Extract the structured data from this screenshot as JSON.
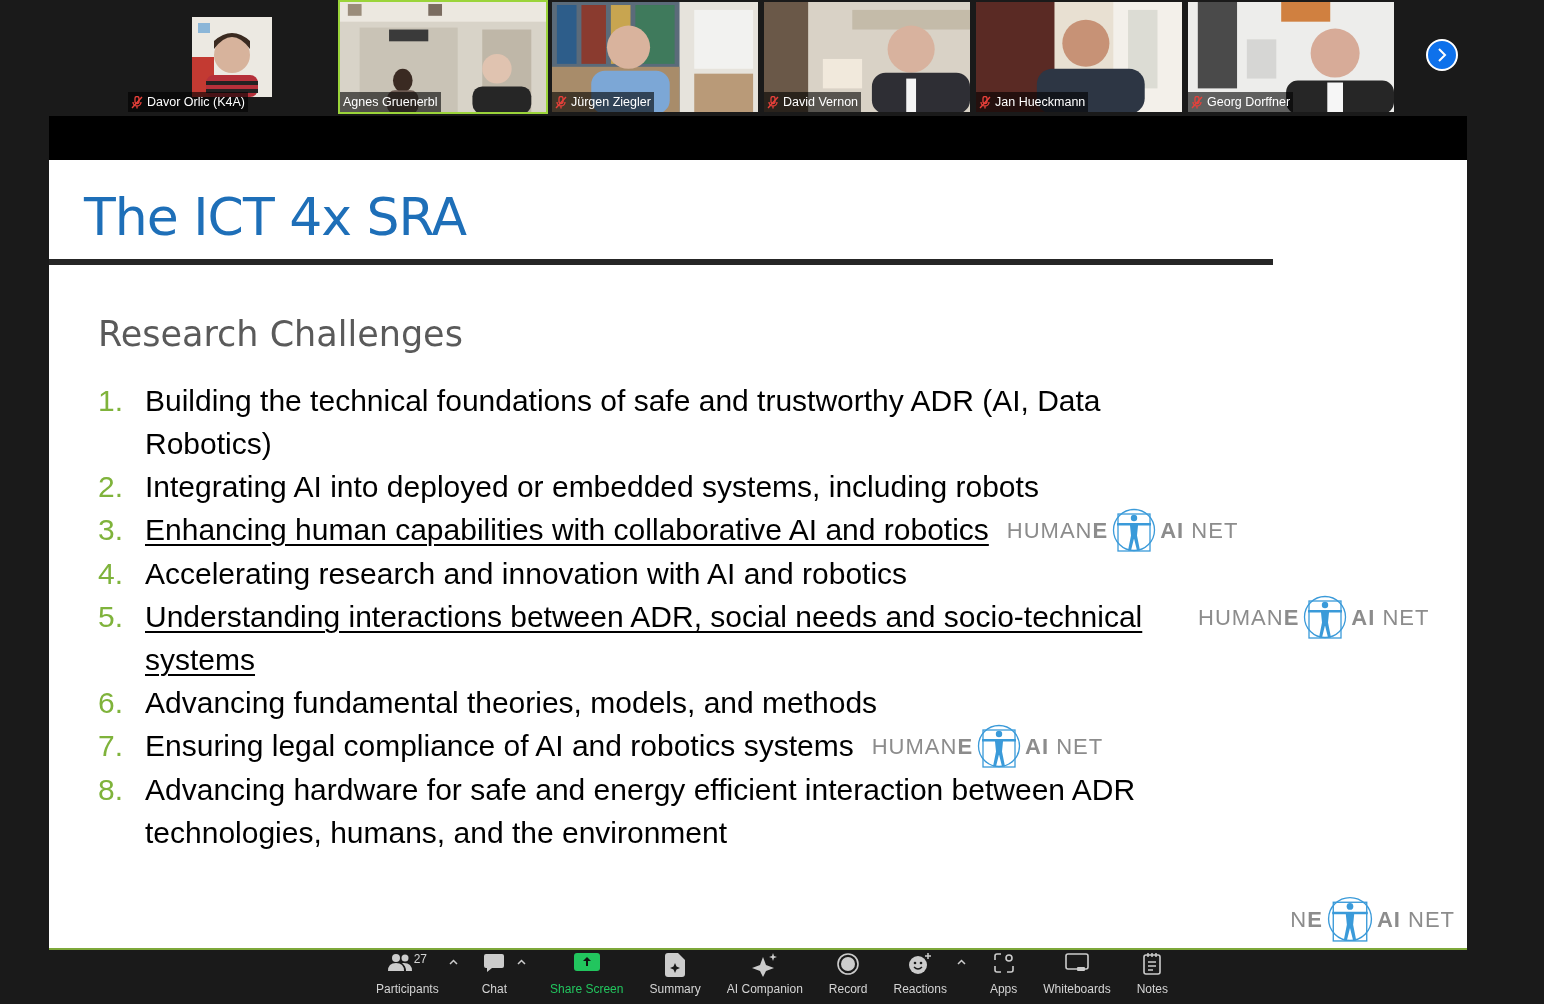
{
  "participants": [
    {
      "name": "Davor Orlic (K4A)",
      "muted": true,
      "speaking": false,
      "kind": "avatar"
    },
    {
      "name": "Agnes Gruenerbl",
      "muted": false,
      "speaking": true,
      "kind": "video"
    },
    {
      "name": "Jürgen Ziegler",
      "muted": true,
      "speaking": false,
      "kind": "video"
    },
    {
      "name": "David Vernon",
      "muted": true,
      "speaking": false,
      "kind": "video"
    },
    {
      "name": "Jan Hueckmann",
      "muted": true,
      "speaking": false,
      "kind": "video"
    },
    {
      "name": "Georg Dorffner",
      "muted": true,
      "speaking": false,
      "kind": "video"
    }
  ],
  "slide": {
    "title": "The ICT 4x SRA",
    "subtitle": "Research Challenges",
    "items": [
      {
        "number": "1.",
        "text": "Building the technical foundations of safe and trustworthy ADR (AI, Data Robotics)",
        "underlined": false
      },
      {
        "number": "2.",
        "text": "Integrating AI into deployed or embedded systems, including robots",
        "underlined": false
      },
      {
        "number": "3.",
        "text": "Enhancing human capabilities with collaborative AI and robotics",
        "underlined": true,
        "logo": {
          "left": "HUMAN**E**",
          "right": "**AI** NET"
        }
      },
      {
        "number": "4.",
        "text": "Accelerating research and innovation with AI and robotics",
        "underlined": false
      },
      {
        "number": "5.",
        "text": "Understanding interactions between ADR, social needs and socio-technical systems",
        "underlined": true,
        "logo": {
          "left": "HUMAN**E**",
          "right": "**AI** NET"
        }
      },
      {
        "number": "6.",
        "text": "Advancing fundamental theories, models, and methods",
        "underlined": false
      },
      {
        "number": "7.",
        "text": "Ensuring legal compliance of AI and robotics systems",
        "underlined": false,
        "logo": {
          "left": "HUMAN**E**",
          "right": "**AI** NET"
        }
      },
      {
        "number": "8.",
        "text": "Advancing hardware for safe and energy efficient interaction between ADR technologies, humans, and the environment",
        "underlined": false
      }
    ],
    "footer_logo": {
      "left": "N**E**",
      "right": "**AI** NET"
    }
  },
  "toolbar": [
    {
      "label": "Participants",
      "kind": "participants",
      "count": "27",
      "caret": true,
      "highlight": false
    },
    {
      "label": "Chat",
      "kind": "chat",
      "caret": true,
      "highlight": false
    },
    {
      "label": "Share Screen",
      "kind": "share",
      "caret": false,
      "highlight": true
    },
    {
      "label": "Summary",
      "kind": "summary",
      "caret": false,
      "highlight": false
    },
    {
      "label": "AI Companion",
      "kind": "ai",
      "caret": false,
      "highlight": false
    },
    {
      "label": "Record",
      "kind": "record",
      "caret": false,
      "highlight": false
    },
    {
      "label": "Reactions",
      "kind": "reactions",
      "caret": true,
      "highlight": false
    },
    {
      "label": "Apps",
      "kind": "apps",
      "caret": false,
      "highlight": false
    },
    {
      "label": "Whiteboards",
      "kind": "whiteboards",
      "caret": false,
      "highlight": false
    },
    {
      "label": "Notes",
      "kind": "notes",
      "caret": false,
      "highlight": false
    }
  ]
}
